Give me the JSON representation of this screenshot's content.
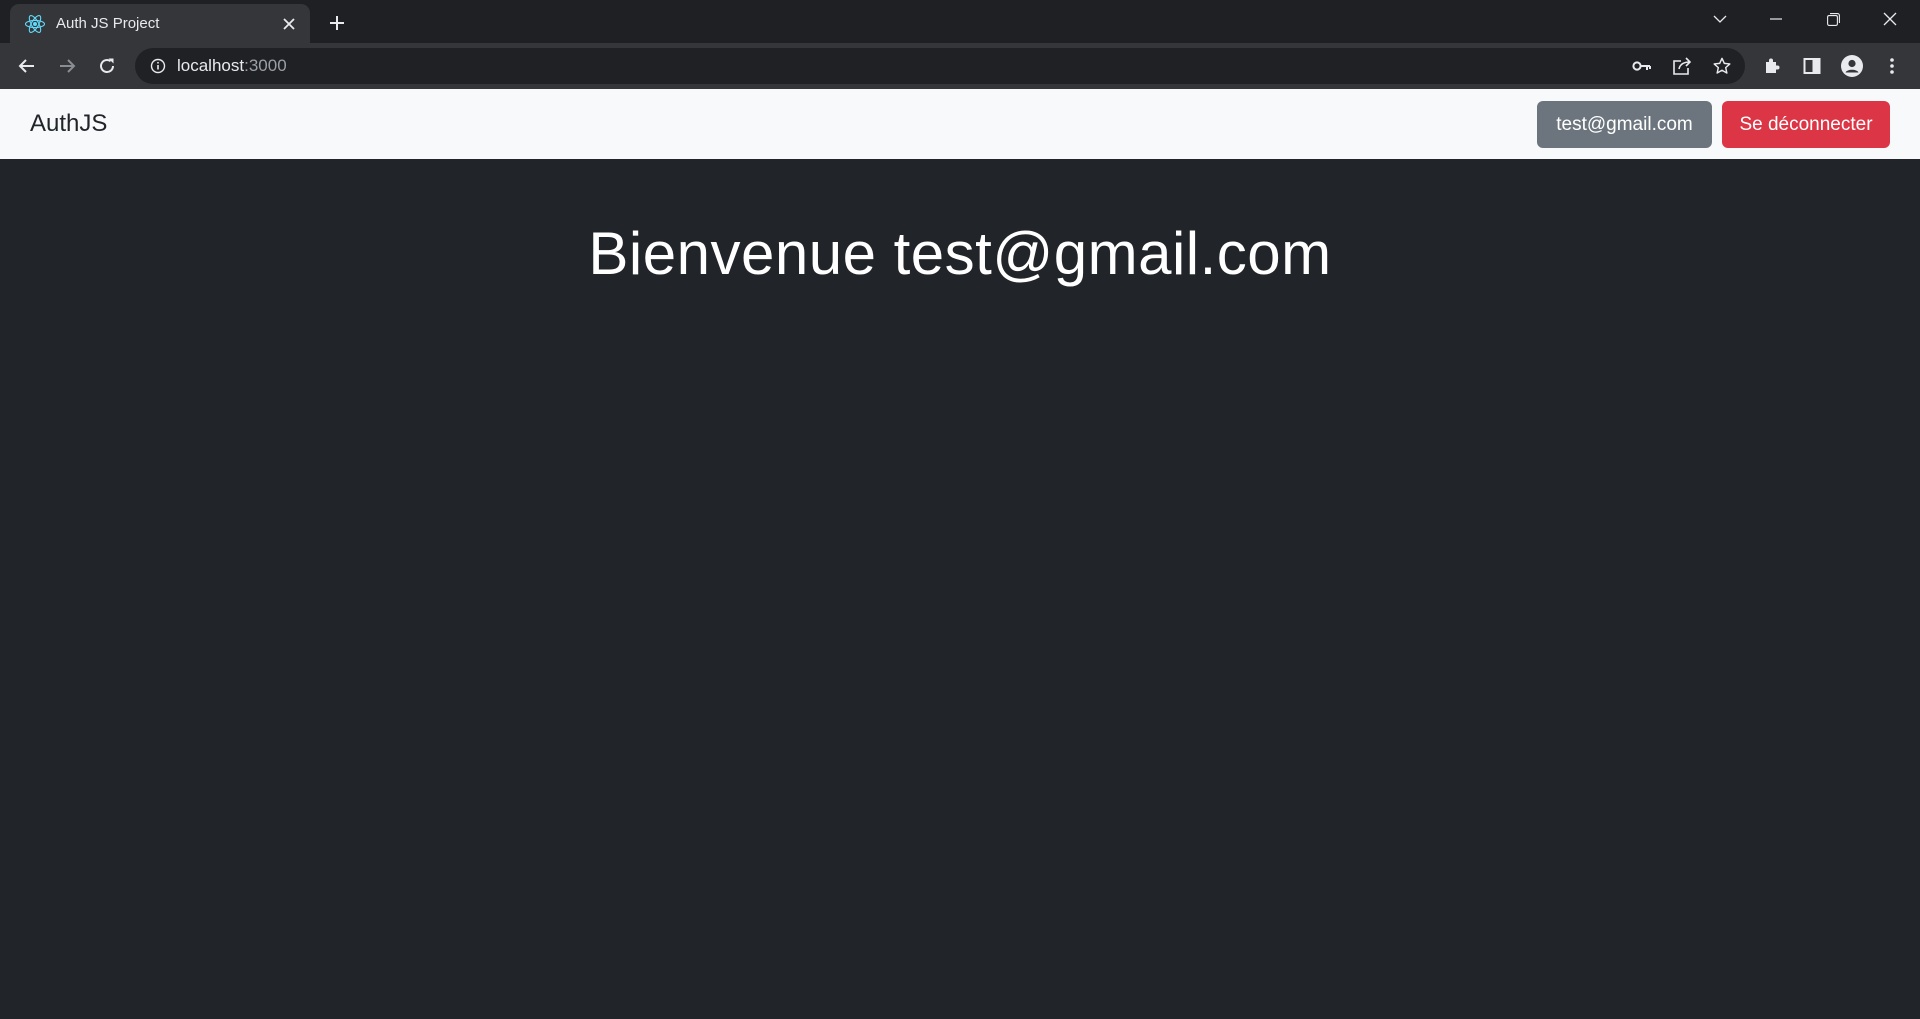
{
  "browser": {
    "tab": {
      "title": "Auth JS Project",
      "favicon": "react-icon"
    },
    "address": {
      "host": "localhost",
      "port": ":3000"
    },
    "accent": "#61dafb"
  },
  "navbar": {
    "brand": "AuthJS",
    "user_button": "test@gmail.com",
    "logout_button": "Se déconnecter"
  },
  "main": {
    "welcome": "Bienvenue test@gmail.com"
  },
  "colors": {
    "page_bg": "#212529",
    "navbar_bg": "#f8f9fa",
    "secondary": "#6c757d",
    "danger": "#dc3545"
  }
}
